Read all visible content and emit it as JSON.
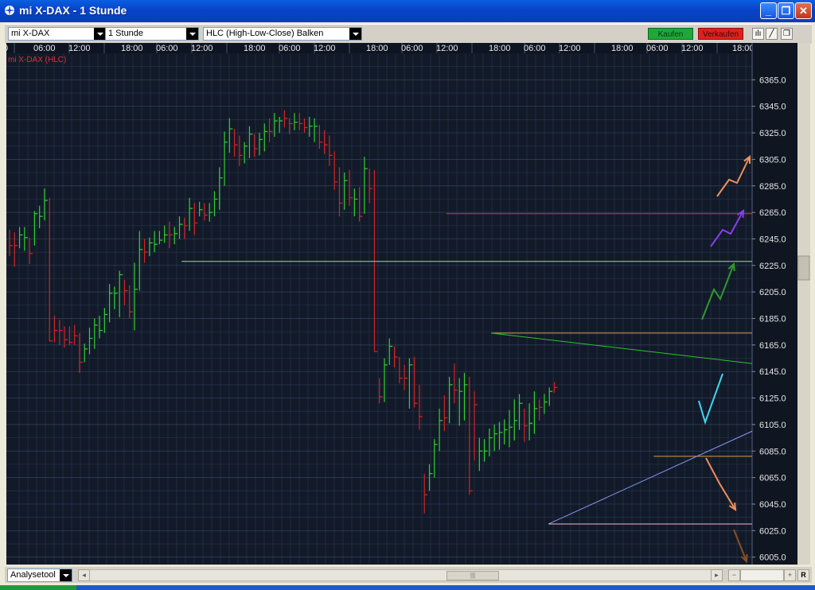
{
  "window": {
    "title": "mi X-DAX - 1 Stunde"
  },
  "toolbar": {
    "instrument": "mi X-DAX",
    "interval": "1 Stunde",
    "chart_style": "HLC (High-Low-Close) Balken",
    "buy_label": "Kaufen",
    "sell_label": "Verkaufen"
  },
  "bottom": {
    "tool_select": "Analysetool",
    "r_label": "R"
  },
  "colors": {
    "background": "#121a29",
    "bull": "#2fd22f",
    "bear": "#d42424",
    "buy_button": "#1fa83a",
    "sell_button": "#e0201c"
  },
  "chart_data": {
    "type": "hlc_bar",
    "title": "mi X-DAX (HLC)",
    "x_tick_labels": [
      "0",
      "06:00",
      "12:00",
      "18:00",
      "06:00",
      "12:00",
      "18:00",
      "06:00",
      "12:00",
      "18:00",
      "06:00",
      "12:00",
      "18:00",
      "06:00",
      "12:00",
      "18:00",
      "06:00",
      "12:00",
      "18:00"
    ],
    "y_tick_labels": [
      "6005.0",
      "6025.0",
      "6045.0",
      "6065.0",
      "6085.0",
      "6105.0",
      "6125.0",
      "6145.0",
      "6165.0",
      "6185.0",
      "6205.0",
      "6225.0",
      "6245.0",
      "6265.0",
      "6285.0",
      "6305.0",
      "6325.0",
      "6345.0",
      "6365.0"
    ],
    "ylim": [
      6000,
      6385
    ],
    "bars": [
      [
        6252,
        6232,
        6240,
        "r"
      ],
      [
        6250,
        6224,
        6240,
        "r"
      ],
      [
        6254,
        6238,
        6248,
        "g"
      ],
      [
        6254,
        6236,
        6246,
        "g"
      ],
      [
        6246,
        6226,
        6234,
        "r"
      ],
      [
        6266,
        6240,
        6264,
        "g"
      ],
      [
        6270,
        6253,
        6262,
        "g"
      ],
      [
        6283,
        6259,
        6274,
        "g"
      ],
      [
        6276,
        6168,
        6168,
        "r"
      ],
      [
        6187,
        6167,
        6176,
        "r"
      ],
      [
        6184,
        6165,
        6176,
        "r"
      ],
      [
        6179,
        6163,
        6169,
        "r"
      ],
      [
        6179,
        6165,
        6167,
        "r"
      ],
      [
        6180,
        6165,
        6172,
        "r"
      ],
      [
        6174,
        6144,
        6152,
        "r"
      ],
      [
        6166,
        6152,
        6162,
        "g"
      ],
      [
        6178,
        6158,
        6170,
        "g"
      ],
      [
        6185,
        6162,
        6180,
        "g"
      ],
      [
        6187,
        6170,
        6176,
        "g"
      ],
      [
        6193,
        6174,
        6188,
        "g"
      ],
      [
        6211,
        6182,
        6204,
        "g"
      ],
      [
        6209,
        6192,
        6204,
        "g"
      ],
      [
        6221,
        6186,
        6218,
        "g"
      ],
      [
        6214,
        6195,
        6206,
        "r"
      ],
      [
        6210,
        6185,
        6190,
        "r"
      ],
      [
        6227,
        6176,
        6207,
        "g"
      ],
      [
        6251,
        6206,
        6237,
        "g"
      ],
      [
        6245,
        6227,
        6235,
        "r"
      ],
      [
        6246,
        6232,
        6242,
        "g"
      ],
      [
        6251,
        6235,
        6241,
        "g"
      ],
      [
        6251,
        6241,
        6244,
        "g"
      ],
      [
        6255,
        6242,
        6248,
        "g"
      ],
      [
        6258,
        6238,
        6248,
        "r"
      ],
      [
        6254,
        6241,
        6249,
        "g"
      ],
      [
        6262,
        6245,
        6256,
        "g"
      ],
      [
        6261,
        6245,
        6255,
        "r"
      ],
      [
        6276,
        6251,
        6268,
        "g"
      ],
      [
        6272,
        6248,
        6257,
        "r"
      ],
      [
        6273,
        6262,
        6267,
        "g"
      ],
      [
        6272,
        6259,
        6263,
        "r"
      ],
      [
        6272,
        6258,
        6265,
        "g"
      ],
      [
        6281,
        6262,
        6275,
        "g"
      ],
      [
        6299,
        6267,
        6291,
        "g"
      ],
      [
        6326,
        6285,
        6318,
        "g"
      ],
      [
        6336,
        6310,
        6328,
        "g"
      ],
      [
        6328,
        6307,
        6316,
        "r"
      ],
      [
        6323,
        6300,
        6308,
        "r"
      ],
      [
        6318,
        6302,
        6315,
        "g"
      ],
      [
        6330,
        6306,
        6324,
        "g"
      ],
      [
        6324,
        6307,
        6313,
        "r"
      ],
      [
        6325,
        6308,
        6320,
        "g"
      ],
      [
        6332,
        6311,
        6326,
        "g"
      ],
      [
        6336,
        6318,
        6326,
        "r"
      ],
      [
        6340,
        6322,
        6334,
        "g"
      ],
      [
        6337,
        6325,
        6334,
        "g"
      ],
      [
        6342,
        6329,
        6336,
        "r"
      ],
      [
        6336,
        6324,
        6332,
        "r"
      ],
      [
        6340,
        6327,
        6333,
        "g"
      ],
      [
        6340,
        6327,
        6332,
        "r"
      ],
      [
        6336,
        6325,
        6329,
        "r"
      ],
      [
        6337,
        6322,
        6330,
        "g"
      ],
      [
        6336,
        6318,
        6330,
        "g"
      ],
      [
        6331,
        6313,
        6318,
        "r"
      ],
      [
        6327,
        6309,
        6316,
        "r"
      ],
      [
        6323,
        6300,
        6308,
        "r"
      ],
      [
        6311,
        6282,
        6288,
        "r"
      ],
      [
        6299,
        6262,
        6272,
        "r"
      ],
      [
        6295,
        6267,
        6289,
        "g"
      ],
      [
        6297,
        6270,
        6276,
        "r"
      ],
      [
        6283,
        6262,
        6275,
        "g"
      ],
      [
        6284,
        6258,
        6262,
        "r"
      ],
      [
        6307,
        6264,
        6298,
        "g"
      ],
      [
        6298,
        6272,
        6283,
        "r"
      ],
      [
        6297,
        6160,
        6160,
        "r"
      ],
      [
        6140,
        6121,
        6126,
        "r"
      ],
      [
        6155,
        6122,
        6150,
        "g"
      ],
      [
        6170,
        6150,
        6164,
        "g"
      ],
      [
        6164,
        6148,
        6156,
        "r"
      ],
      [
        6156,
        6136,
        6140,
        "r"
      ],
      [
        6150,
        6131,
        6140,
        "r"
      ],
      [
        6155,
        6117,
        6150,
        "g"
      ],
      [
        6156,
        6118,
        6121,
        "r"
      ],
      [
        6135,
        6101,
        6111,
        "r"
      ],
      [
        6068,
        6038,
        6052,
        "r"
      ],
      [
        6075,
        6055,
        6068,
        "g"
      ],
      [
        6094,
        6065,
        6090,
        "g"
      ],
      [
        6117,
        6085,
        6108,
        "g"
      ],
      [
        6127,
        6100,
        6110,
        "r"
      ],
      [
        6141,
        6106,
        6135,
        "g"
      ],
      [
        6151,
        6121,
        6131,
        "r"
      ],
      [
        6140,
        6104,
        6130,
        "g"
      ],
      [
        6144,
        6108,
        6135,
        "g"
      ],
      [
        6141,
        6052,
        6055,
        "r"
      ],
      [
        6130,
        6078,
        6120,
        "r"
      ],
      [
        6095,
        6070,
        6085,
        "g"
      ],
      [
        6094,
        6077,
        6085,
        "g"
      ],
      [
        6102,
        6081,
        6095,
        "g"
      ],
      [
        6105,
        6085,
        6098,
        "g"
      ],
      [
        6107,
        6086,
        6099,
        "g"
      ],
      [
        6109,
        6090,
        6101,
        "g"
      ],
      [
        6116,
        6088,
        6103,
        "g"
      ],
      [
        6124,
        6093,
        6108,
        "g"
      ],
      [
        6128,
        6101,
        6121,
        "g"
      ],
      [
        6117,
        6092,
        6104,
        "r"
      ],
      [
        6121,
        6093,
        6106,
        "g"
      ],
      [
        6130,
        6098,
        6117,
        "g"
      ],
      [
        6124,
        6108,
        6118,
        "r"
      ],
      [
        6128,
        6113,
        6122,
        "g"
      ],
      [
        6133,
        6119,
        6130,
        "g"
      ],
      [
        6137,
        6129,
        6133,
        "r"
      ]
    ],
    "bar_start_index": 0,
    "lines": [
      {
        "name": "resistance-red",
        "color": "#e0303a",
        "x0": 0.59,
        "x1": 1.0,
        "y0": 6264,
        "y1": 6264
      },
      {
        "name": "resistance-green",
        "color": "#a8d8a0",
        "x0": 0.235,
        "x1": 1.0,
        "y0": 6228,
        "y1": 6228
      },
      {
        "name": "level-orange-top",
        "color": "#d8a040",
        "x0": 0.65,
        "x1": 1.0,
        "y0": 6174,
        "y1": 6174
      },
      {
        "name": "trend-green-down",
        "color": "#30c030",
        "x0": 0.65,
        "x1": 1.0,
        "y0": 6174,
        "y1": 6151
      },
      {
        "name": "level-orange-mid",
        "color": "#d8a040",
        "x0": 0.868,
        "x1": 1.0,
        "y0": 6081,
        "y1": 6081
      },
      {
        "name": "trend-blue-up",
        "color": "#8898f0",
        "x0": 0.727,
        "x1": 1.0,
        "y0": 6030,
        "y1": 6100
      },
      {
        "name": "support-pink",
        "color": "#f0b8d0",
        "x0": 0.727,
        "x1": 1.0,
        "y0": 6030,
        "y1": 6030
      }
    ]
  }
}
